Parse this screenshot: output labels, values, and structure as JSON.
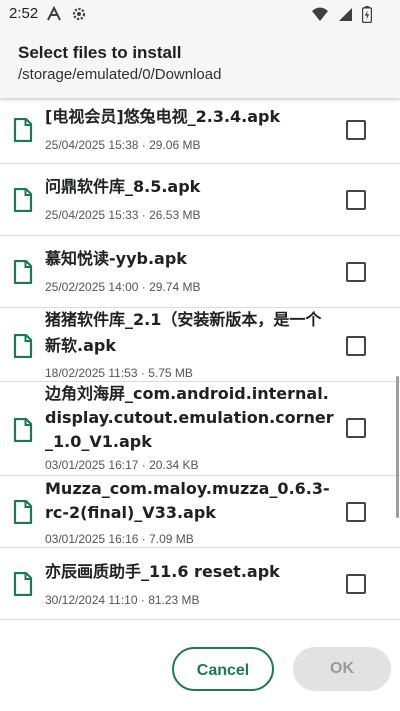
{
  "status_bar": {
    "time": "2:52",
    "icons_left": [
      "font-a-icon",
      "gear-icon"
    ],
    "icons_right": [
      "wifi-icon",
      "cellular-signal-icon",
      "battery-icon"
    ]
  },
  "header": {
    "title": "Select files to install",
    "path": "/storage/emulated/0/Download"
  },
  "files": [
    {
      "name": "[电视会员]悠兔电视_2.3.4.apk",
      "meta": "25/04/2025 15:38 · 29.06 MB",
      "checked": false
    },
    {
      "name": "问鼎软件库_8.5.apk",
      "meta": "25/04/2025 15:33 · 26.53 MB",
      "checked": false
    },
    {
      "name": "慕知悦读-yyb.apk",
      "meta": "25/02/2025 14:00 · 29.74 MB",
      "checked": false
    },
    {
      "name": "猪猪软件库_2.1（安装新版本，是一个新软.apk",
      "meta": "18/02/2025 11:53 · 5.75 MB",
      "checked": false
    },
    {
      "name": "边角刘海屏_com.android.internal.display.cutout.emulation.corner_1.0_V1.apk",
      "meta": "03/01/2025 16:17 · 20.34 KB",
      "checked": false
    },
    {
      "name": "Muzza_com.maloy.muzza_0.6.3-rc-2(final)_V33.apk",
      "meta": "03/01/2025 16:16 · 7.09 MB",
      "checked": false
    },
    {
      "name": "亦辰画质助手_11.6 reset.apk",
      "meta": "30/12/2024 11:10 · 81.23 MB",
      "checked": false
    }
  ],
  "footer": {
    "cancel_label": "Cancel",
    "ok_label": "OK"
  },
  "colors": {
    "accent": "#1b7a4e",
    "disabled_bg": "#e2e2e2",
    "disabled_text": "#9a9a9a"
  }
}
